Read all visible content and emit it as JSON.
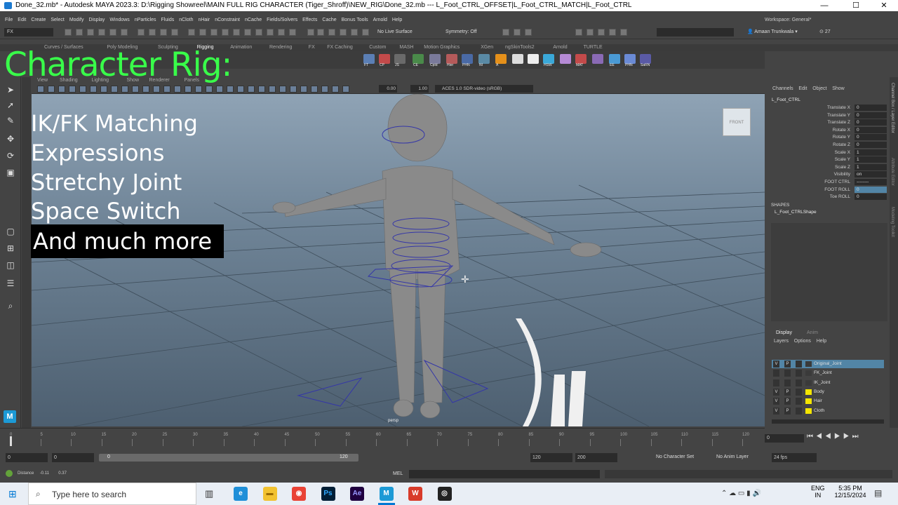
{
  "window": {
    "title": "Done_32.mb* - Autodesk MAYA 2023.3: D:\\Rigging Showreel\\MAIN FULL RIG CHARACTER (Tiger_Shroff)\\NEW_RIG\\Done_32.mb   ---   L_Foot_CTRL_OFFSET|L_Foot_CTRL_MATCH|L_Foot_CTRL",
    "controls": [
      "—",
      "☐",
      "✕"
    ]
  },
  "menubar": [
    "File",
    "Edit",
    "Create",
    "Select",
    "Modify",
    "Display",
    "Windows",
    "nParticles",
    "Fluids",
    "nCloth",
    "nHair",
    "nConstraint",
    "nCache",
    "Fields/Solvers",
    "Effects",
    "Cache",
    "Bonus Tools",
    "Arnold",
    "Help"
  ],
  "workspace": {
    "label": "Workspace:",
    "value": "General*"
  },
  "statusline": {
    "mode": "FX",
    "live_surface": "No Live Surface",
    "symmetry": "Symmetry: Off",
    "user": "Amaan Trunkwala",
    "notifications": "27"
  },
  "shelf_tabs": [
    "Curves / Surfaces",
    "Poly Modeling",
    "Sculpting",
    "Rigging",
    "Animation",
    "Rendering",
    "FX",
    "FX Caching",
    "Custom",
    "MASH",
    "Motion Graphics",
    "XGen",
    "ngSkinTools2",
    "Arnold",
    "TURTLE"
  ],
  "shelf_icons": [
    "FT",
    "CP",
    "JS",
    "CE",
    "CpId",
    "Hier",
    "PHN",
    "NI",
    "A",
    "",
    "",
    "HSW",
    "",
    "MAT",
    "",
    "EE",
    "PHN",
    "SaRN"
  ],
  "overlay": {
    "title": "Character Rig:",
    "features": [
      "IK/FK Matching",
      "Expressions",
      "Stretchy Joint",
      "Space Switch"
    ],
    "highlight": "And much more"
  },
  "viewport": {
    "menu": [
      "View",
      "Shading",
      "Lighting",
      "Show",
      "Renderer",
      "Panels"
    ],
    "exposure": "0.00",
    "gamma": "1.00",
    "color_space": "ACES 1.0 SDR-video (sRGB)",
    "camera": "persp",
    "viewcube": "FRONT"
  },
  "channelbox": {
    "menu": [
      "Channels",
      "Edit",
      "Object",
      "Show"
    ],
    "node": "L_Foot_CTRL",
    "channels": [
      {
        "name": "Translate X",
        "value": "0"
      },
      {
        "name": "Translate Y",
        "value": "0"
      },
      {
        "name": "Translate Z",
        "value": "0"
      },
      {
        "name": "Rotate X",
        "value": "0"
      },
      {
        "name": "Rotate Y",
        "value": "0"
      },
      {
        "name": "Rotate Z",
        "value": "0"
      },
      {
        "name": "Scale X",
        "value": "1"
      },
      {
        "name": "Scale Y",
        "value": "1"
      },
      {
        "name": "Scale Z",
        "value": "1"
      },
      {
        "name": "Visibility",
        "value": "on"
      },
      {
        "name": "FOOT CTRL",
        "value": "--------"
      },
      {
        "name": "FOOT ROLL",
        "value": "0"
      },
      {
        "name": "Toe ROLL",
        "value": "0"
      }
    ],
    "shapes_label": "SHAPES",
    "shape": "L_Foot_CTRLShape"
  },
  "side_tabs": [
    "Channel Box / Layer Editor",
    "Attribute Editor",
    "Modeling Toolkit"
  ],
  "layers": {
    "tabs": [
      "Display",
      "Anim"
    ],
    "menu": [
      "Layers",
      "Options",
      "Help"
    ],
    "items": [
      {
        "v": "V",
        "p": "P",
        "name": "Original_Joint",
        "color": "#3a3a3a",
        "selected": true
      },
      {
        "v": "",
        "p": "",
        "name": "FK_Joint",
        "color": "#3a3a3a",
        "selected": false
      },
      {
        "v": "",
        "p": "",
        "name": "IK_Joint",
        "color": "#3a3a3a",
        "selected": false
      },
      {
        "v": "V",
        "p": "P",
        "name": "Body",
        "color": "#f5e600",
        "selected": false
      },
      {
        "v": "V",
        "p": "P",
        "name": "Hair",
        "color": "#f5e600",
        "selected": false
      },
      {
        "v": "V",
        "p": "P",
        "name": "Cloth",
        "color": "#f5e600",
        "selected": false
      }
    ]
  },
  "timeline": {
    "ticks": [
      "0",
      "5",
      "10",
      "15",
      "20",
      "25",
      "30",
      "35",
      "40",
      "45",
      "50",
      "55",
      "60",
      "65",
      "70",
      "75",
      "80",
      "85",
      "90",
      "95",
      "100",
      "105",
      "110",
      "115",
      "120"
    ],
    "current_frame": "0",
    "range_start": "0",
    "anim_start": "0",
    "range_slider_start": "0",
    "range_slider_end": "120",
    "range_end": "120",
    "anim_end": "200",
    "character_set": "No Character Set",
    "anim_layer": "No Anim Layer",
    "fps": "24 fps"
  },
  "helpline": {
    "distance_label": "Distance",
    "value1": "-0.11",
    "value2": "0.37"
  },
  "cmdline": {
    "lang": "MEL"
  },
  "taskbar": {
    "search_placeholder": "Type here to search",
    "language": "ENG",
    "region": "IN",
    "time": "5:35 PM",
    "date": "12/15/2024",
    "apps": [
      "Edge",
      "File Explorer",
      "Chrome",
      "Ps",
      "Ae",
      "M",
      "W",
      "OBS"
    ]
  }
}
